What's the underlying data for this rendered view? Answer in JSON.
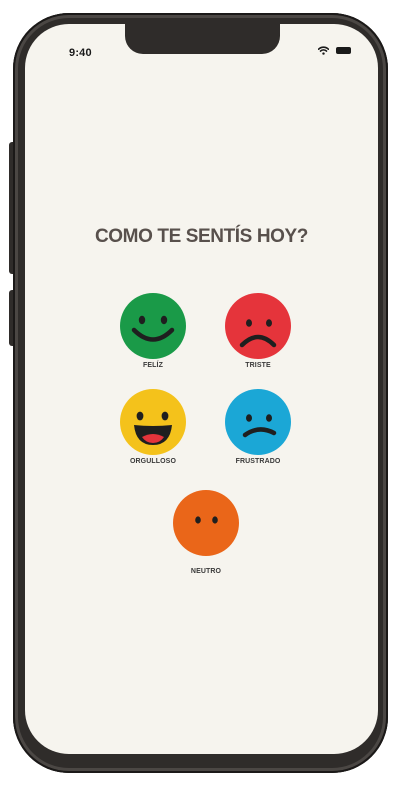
{
  "status_bar": {
    "time": "9:40",
    "icons": [
      "wifi-icon",
      "battery-icon"
    ]
  },
  "screen": {
    "title": "COMO TE SENTÍS HOY?"
  },
  "moods": [
    {
      "key": "feliz",
      "label": "FELÍZ",
      "color": "#1a9a48",
      "icon": "happy-face-icon"
    },
    {
      "key": "triste",
      "label": "TRISTE",
      "color": "#e5343b",
      "icon": "sad-face-icon"
    },
    {
      "key": "orgulloso",
      "label": "ORGULLOSO",
      "color": "#f4c21b",
      "icon": "grinning-face-icon"
    },
    {
      "key": "frustrado",
      "label": "FRUSTRADO",
      "color": "#1ba7d6",
      "icon": "frustrated-face-icon"
    },
    {
      "key": "neutro",
      "label": "NEUTRO",
      "color": "#ea6619",
      "icon": "neutral-face-icon"
    }
  ],
  "colors": {
    "background": "#f6f4ee",
    "title": "#58504c",
    "device_frame": "#2f2c2a"
  }
}
